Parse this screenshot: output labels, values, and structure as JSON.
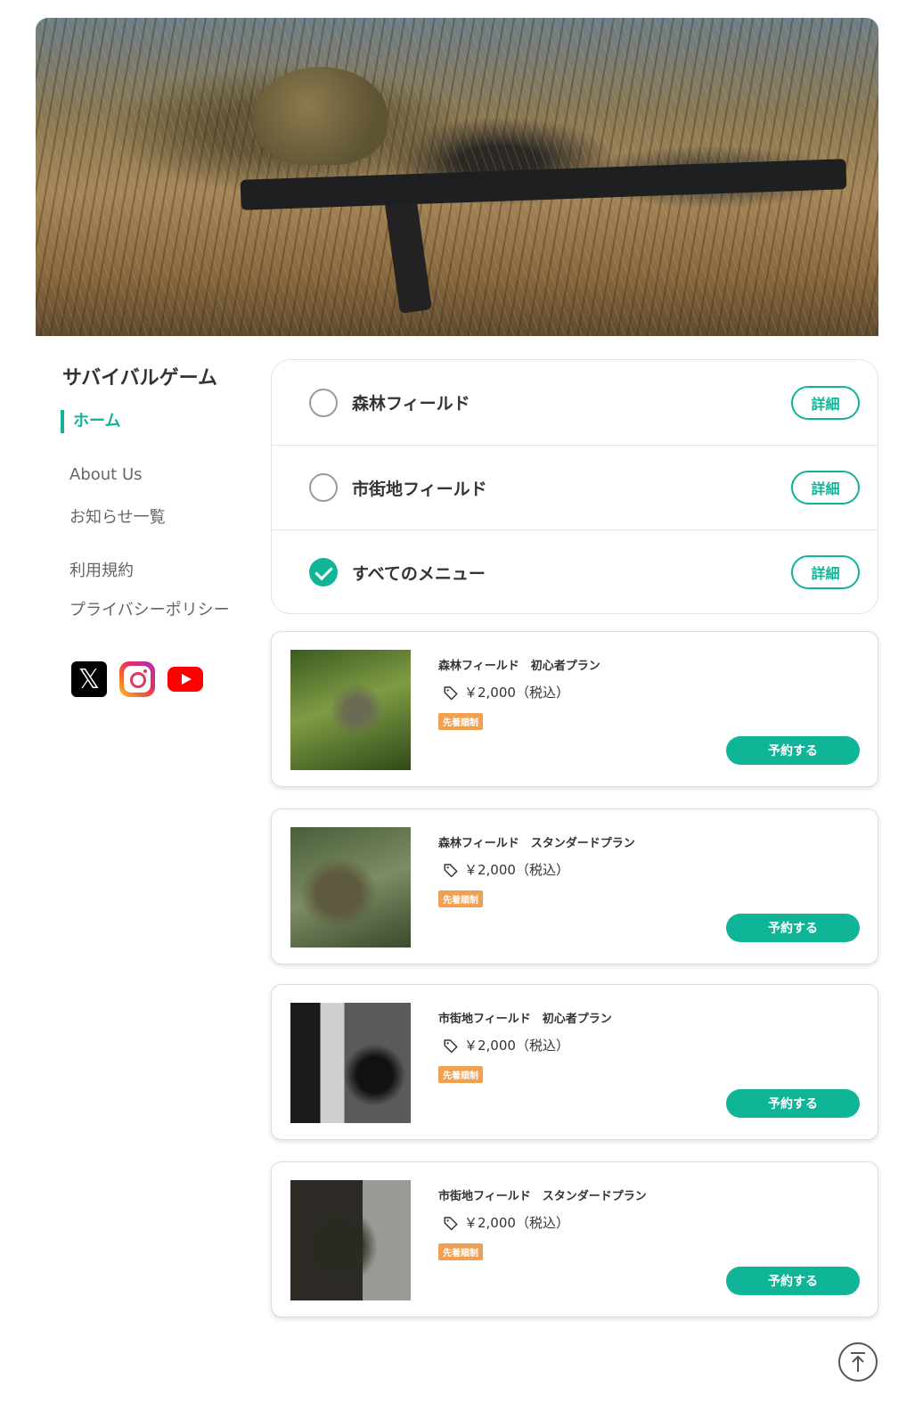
{
  "site": {
    "title": "サバイバルゲーム"
  },
  "nav": {
    "home": "ホーム",
    "links": [
      "About Us",
      "お知らせ一覧",
      "利用規約",
      "プライバシーポリシー"
    ]
  },
  "social": {
    "icons": [
      "x-icon",
      "instagram-icon",
      "youtube-icon"
    ]
  },
  "categories": [
    {
      "label": "森林フィールド",
      "selected": false,
      "button": "詳細"
    },
    {
      "label": "市街地フィールド",
      "selected": false,
      "button": "詳細"
    },
    {
      "label": "すべてのメニュー",
      "selected": true,
      "button": "詳細"
    }
  ],
  "plans": [
    {
      "title": "森林フィールド　初心者プラン",
      "price": "￥2,000（税込）",
      "badge": "先着順制",
      "button": "予約する"
    },
    {
      "title": "森林フィールド　スタンダードプラン",
      "price": "￥2,000（税込）",
      "badge": "先着順制",
      "button": "予約する"
    },
    {
      "title": "市街地フィールド　初心者プラン",
      "price": "￥2,000（税込）",
      "badge": "先着順制",
      "button": "予約する"
    },
    {
      "title": "市街地フィールド　スタンダードプラン",
      "price": "￥2,000（税込）",
      "badge": "先着順制",
      "button": "予約する"
    }
  ],
  "colors": {
    "accent": "#10b496",
    "badge": "#f0a050"
  }
}
